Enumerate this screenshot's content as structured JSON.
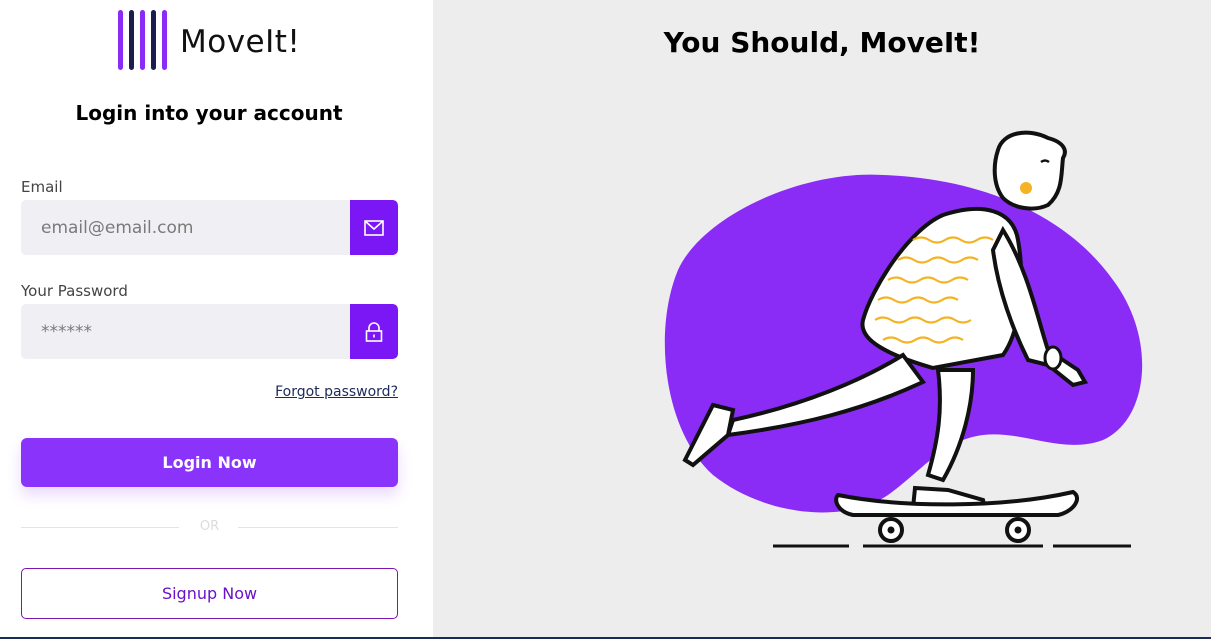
{
  "brand": {
    "name": "MoveIt!",
    "icon": "logo-bars-icon",
    "colors": {
      "purple": "#8a2cf5",
      "navy": "#1c1c4f"
    }
  },
  "login": {
    "heading": "Login into your account",
    "email": {
      "label": "Email",
      "placeholder": "email@email.com",
      "icon": "mail-icon"
    },
    "password": {
      "label": "Your Password",
      "placeholder": "******",
      "icon": "lock-icon"
    },
    "forgot": "Forgot password?",
    "submit": "Login Now",
    "divider": "OR",
    "signup": "Signup Now"
  },
  "hero": {
    "tagline": "You Should, MoveIt!",
    "illustration": "skateboarder-illustration"
  },
  "colors": {
    "accent": "#8a33fa",
    "icon_button": "#7b16f5",
    "panel_bg": "#ededee"
  }
}
